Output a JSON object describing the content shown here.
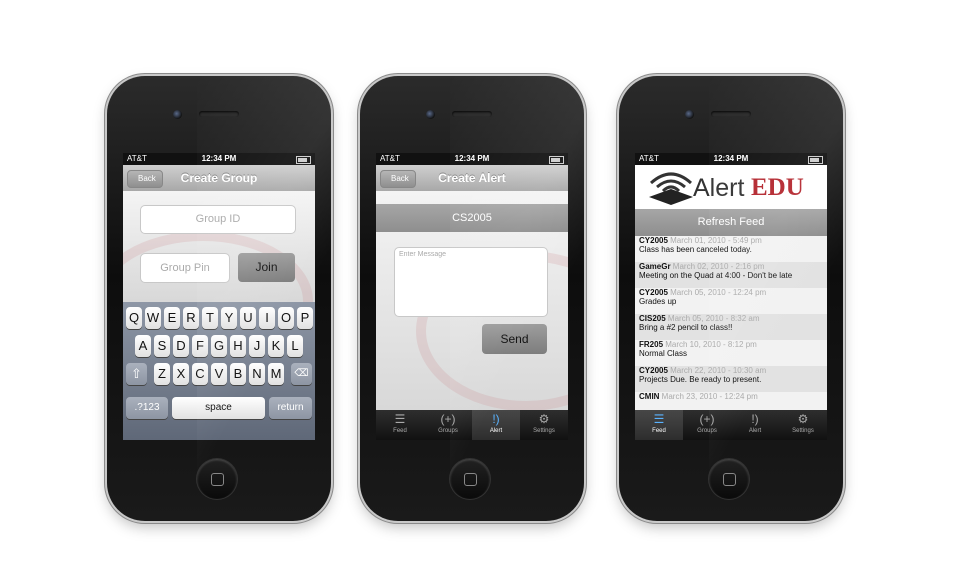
{
  "status": {
    "carrier": "AT&T",
    "time": "12:34 PM"
  },
  "phone1": {
    "back": "Back",
    "title": "Create Group",
    "group_id_placeholder": "Group ID",
    "group_pin_placeholder": "Group Pin",
    "join": "Join",
    "keyboard": {
      "row1": [
        "Q",
        "W",
        "E",
        "R",
        "T",
        "Y",
        "U",
        "I",
        "O",
        "P"
      ],
      "row2": [
        "A",
        "S",
        "D",
        "F",
        "G",
        "H",
        "J",
        "K",
        "L"
      ],
      "row3": [
        "Z",
        "X",
        "C",
        "V",
        "B",
        "N",
        "M"
      ],
      "numbers": ".?123",
      "space": "space",
      "return": "return"
    }
  },
  "phone2": {
    "back": "Back",
    "title": "Create Alert",
    "group_name": "CS2005",
    "message_placeholder": "Enter Message",
    "send": "Send"
  },
  "phone3": {
    "logo_prefix": "Alert",
    "logo_suffix": "EDU",
    "refresh": "Refresh Feed",
    "feed": [
      {
        "code": "CY2005",
        "date": "March 01, 2010 - 5:49 pm",
        "msg": "Class has been canceled today."
      },
      {
        "code": "GameGr",
        "date": "March 02, 2010 - 2:16 pm",
        "msg": "Meeting on the Quad at 4:00 - Don't be late"
      },
      {
        "code": "CY2005",
        "date": "March 05, 2010 - 12:24 pm",
        "msg": "Grades up"
      },
      {
        "code": "CIS205",
        "date": "March 05, 2010 - 8:32 am",
        "msg": "Bring a #2 pencil to class!!"
      },
      {
        "code": "FR205",
        "date": "March 10, 2010 - 8:12 pm",
        "msg": "Normal Class"
      },
      {
        "code": "CY2005",
        "date": "March 22, 2010 - 10:30 am",
        "msg": "Projects Due. Be ready to present."
      },
      {
        "code": "CMIN",
        "date": "March 23, 2010 - 12:24 pm",
        "msg": ""
      }
    ]
  },
  "tabs": [
    {
      "label": "Feed",
      "icon": "list-icon"
    },
    {
      "label": "Groups",
      "icon": "groups-icon"
    },
    {
      "label": "Alert",
      "icon": "alert-icon"
    },
    {
      "label": "Settings",
      "icon": "gear-icon"
    }
  ],
  "colors": {
    "brand_red": "#b3252d",
    "active_tab": "#5ab3ff"
  }
}
